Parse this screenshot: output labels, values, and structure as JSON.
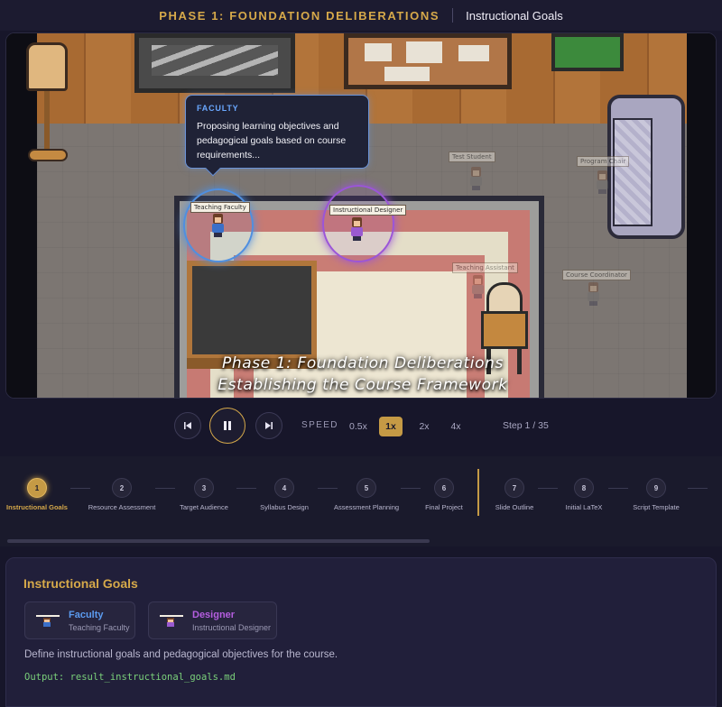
{
  "header": {
    "phase_title": "PHASE 1: FOUNDATION DELIBERATIONS",
    "goal_title": "Instructional Goals"
  },
  "scene": {
    "bubble": {
      "speaker": "FACULTY",
      "message": "Proposing learning objectives and pedagogical goals based on course requirements..."
    },
    "name_tags": {
      "teaching_faculty": "Teaching Faculty",
      "instructional_designer": "Instructional Designer",
      "test_student": "Test Student",
      "program_chair": "Program Chair",
      "teaching_assistant": "Teaching Assistant",
      "course_coordinator": "Course Coordinator"
    },
    "overlay_line1": "Phase 1: Foundation Deliberations",
    "overlay_line2": "Establishing the Course Framework"
  },
  "controls": {
    "prev_icon": "skip-previous-icon",
    "play_state_icon": "pause-icon",
    "next_icon": "skip-next-icon",
    "speed_label": "SPEED",
    "speeds": [
      "0.5x",
      "1x",
      "2x",
      "4x"
    ],
    "selected_speed": "1x",
    "step_text": "Step 1 / 35"
  },
  "timeline": {
    "steps": [
      {
        "num": "1",
        "label": "Instructional Goals",
        "active": true
      },
      {
        "num": "2",
        "label": "Resource Assessment"
      },
      {
        "num": "3",
        "label": "Target Audience"
      },
      {
        "num": "4",
        "label": "Syllabus Design"
      },
      {
        "num": "5",
        "label": "Assessment Planning"
      },
      {
        "num": "6",
        "label": "Final Project"
      },
      {
        "num": "7",
        "label": "Slide Outline"
      },
      {
        "num": "8",
        "label": "Initial LaTeX"
      },
      {
        "num": "9",
        "label": "Script Template"
      }
    ]
  },
  "detail": {
    "title": "Instructional Goals",
    "agents": [
      {
        "name": "Faculty",
        "role": "Teaching Faculty",
        "color": "#5b9bf0"
      },
      {
        "name": "Designer",
        "role": "Instructional Designer",
        "color": "#b55ee0"
      }
    ],
    "description": "Define instructional goals and pedagogical objectives for the course.",
    "output": "Output: result_instructional_goals.md"
  },
  "colors": {
    "accent_gold": "#c59a45",
    "faculty_blue": "#4f8fe0",
    "designer_purple": "#9b55d8",
    "output_green": "#7ad07a"
  }
}
